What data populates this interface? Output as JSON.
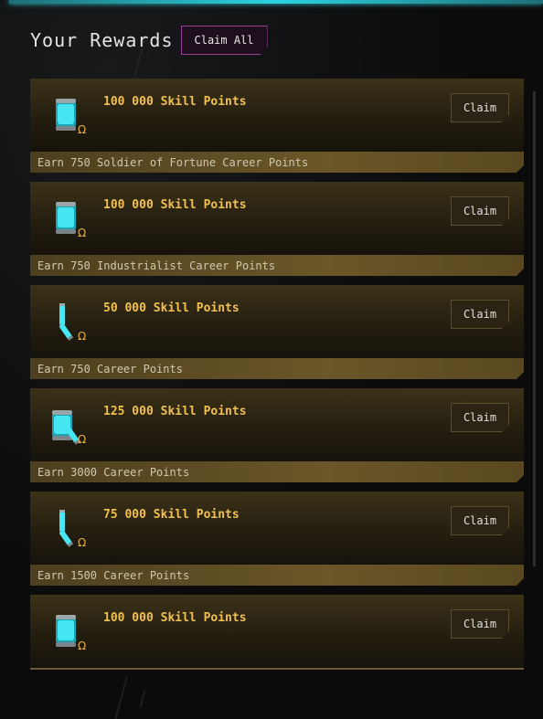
{
  "header": {
    "title": "Your Rewards",
    "claim_all_label": "Claim All"
  },
  "rewards": [
    {
      "amount": "100 000 Skill Points",
      "claim_label": "Claim",
      "icon": "skill-injector-large-icon",
      "requirement": "Earn 750 Soldier of Fortune Career Points"
    },
    {
      "amount": "100 000 Skill Points",
      "claim_label": "Claim",
      "icon": "skill-injector-large-icon",
      "requirement": "Earn 750 Industrialist Career Points"
    },
    {
      "amount": "50 000 Skill Points",
      "claim_label": "Claim",
      "icon": "skill-injector-small-icon",
      "requirement": "Earn 750 Career Points"
    },
    {
      "amount": "125 000 Skill Points",
      "claim_label": "Claim",
      "icon": "skill-injector-combo-icon",
      "requirement": "Earn 3000 Career Points"
    },
    {
      "amount": "75 000 Skill Points",
      "claim_label": "Claim",
      "icon": "skill-injector-small-icon",
      "requirement": "Earn 1500 Career Points"
    },
    {
      "amount": "100 000 Skill Points",
      "claim_label": "Claim",
      "icon": "skill-injector-large-icon",
      "requirement": ""
    }
  ],
  "colors": {
    "accent_cyan": "#2bd3e0",
    "gold_text": "#f0c050",
    "claim_all_border": "#9b3d92"
  }
}
